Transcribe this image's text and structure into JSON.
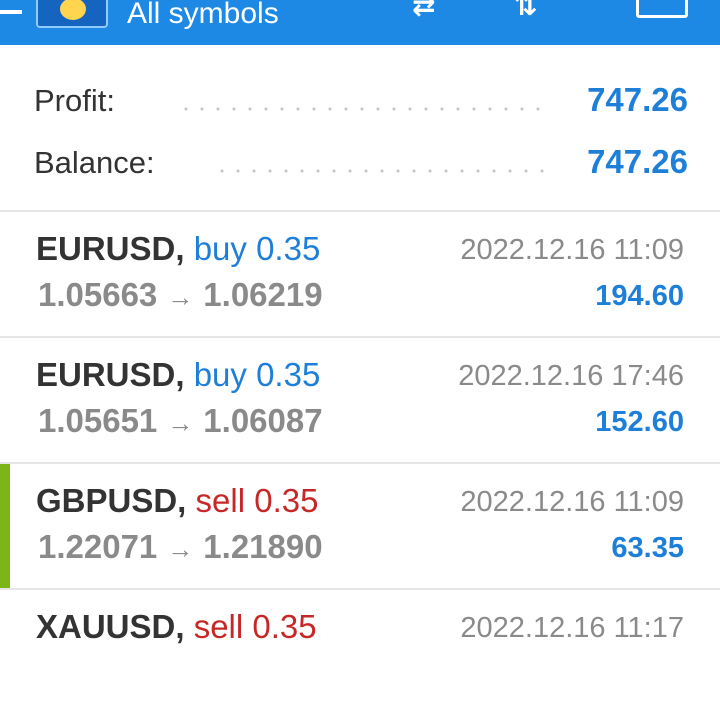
{
  "header": {
    "title": "All symbols",
    "icons": [
      "menu-icon",
      "app-logo",
      "sync-icon",
      "sort-icon",
      "calculator-icon"
    ]
  },
  "summary": {
    "profit_label": "Profit:",
    "profit_value": "747.26",
    "balance_label": "Balance:",
    "balance_value": "747.26"
  },
  "trades": [
    {
      "symbol": "EURUSD,",
      "side": "buy 0.35",
      "time": "2022.12.16 11:09",
      "open": "1.05663",
      "arrow": "→",
      "close": "1.06219",
      "profit": "194.60"
    },
    {
      "symbol": "EURUSD,",
      "side": "buy 0.35",
      "time": "2022.12.16 17:46",
      "open": "1.05651",
      "arrow": "→",
      "close": "1.06087",
      "profit": "152.60"
    },
    {
      "symbol": "GBPUSD,",
      "side": "sell 0.35",
      "time": "2022.12.16 11:09",
      "open": "1.22071",
      "arrow": "→",
      "close": "1.21890",
      "profit": "63.35"
    },
    {
      "symbol": "XAUUSD,",
      "side": "sell 0.35",
      "time": "2022.12.16 11:17",
      "open": "",
      "arrow": "",
      "close": "",
      "profit": ""
    }
  ],
  "colors": {
    "accent": "#1e88e5",
    "buy": "#1e7fd8",
    "sell": "#c62828",
    "selected_marker": "#7cb518"
  }
}
